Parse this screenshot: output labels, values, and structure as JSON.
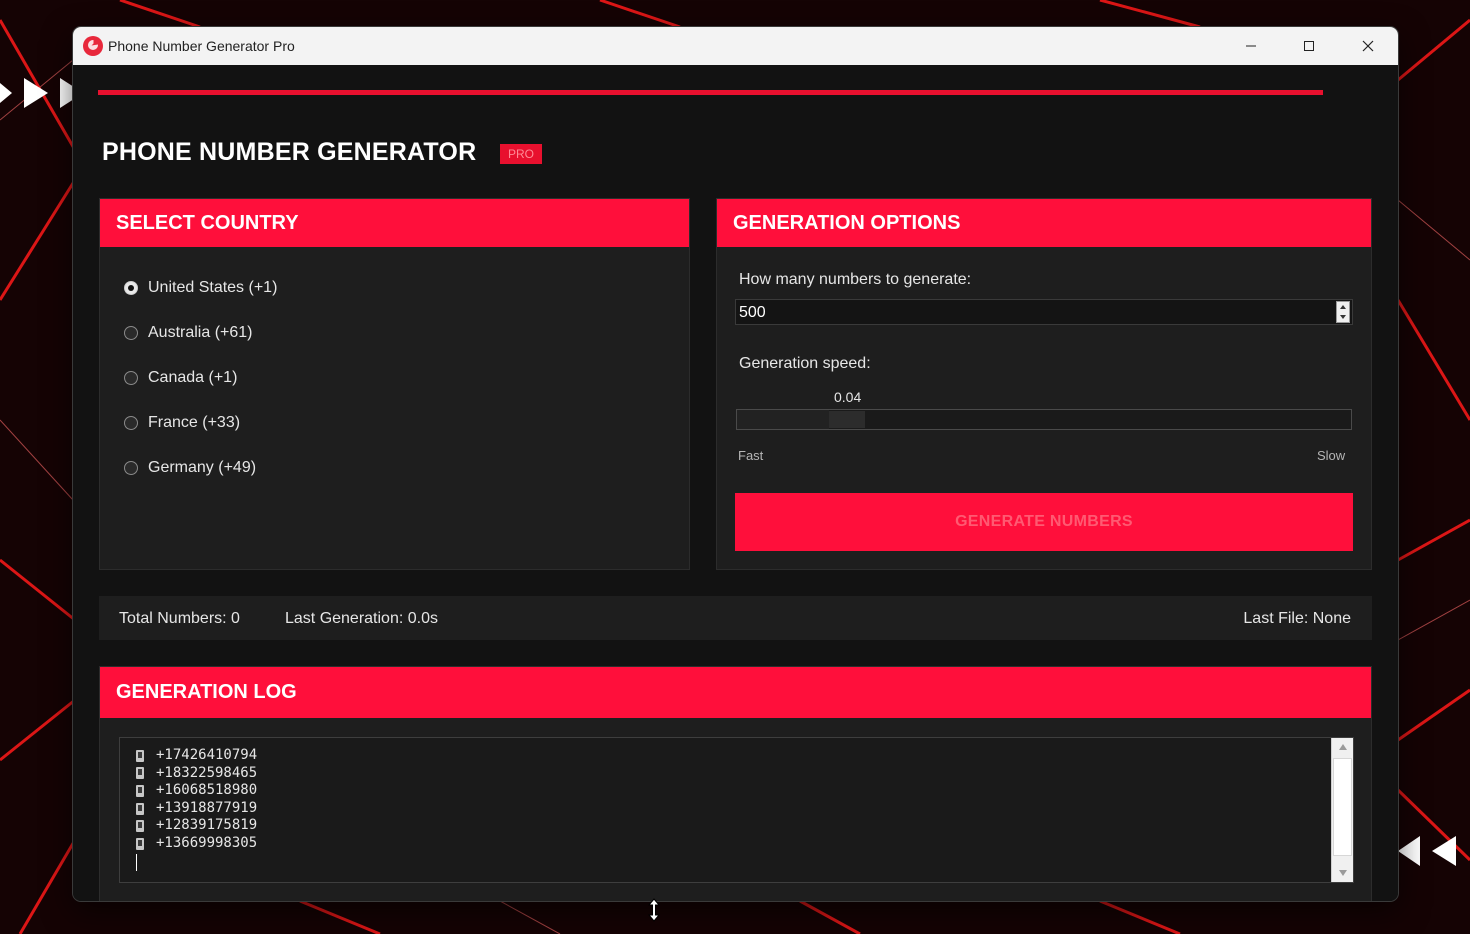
{
  "window": {
    "title": "Phone Number Generator Pro",
    "minimize_icon": "minimize-icon",
    "maximize_icon": "maximize-icon",
    "close_icon": "close-icon"
  },
  "header": {
    "title": "PHONE NUMBER GENERATOR",
    "badge": "PRO",
    "accent_color": "#ff0f3b"
  },
  "country_panel": {
    "title": "SELECT COUNTRY",
    "options": [
      {
        "label": "United States (+1)",
        "selected": true
      },
      {
        "label": "Australia (+61)",
        "selected": false
      },
      {
        "label": "Canada (+1)",
        "selected": false
      },
      {
        "label": "France (+33)",
        "selected": false
      },
      {
        "label": "Germany (+49)",
        "selected": false
      }
    ]
  },
  "options_panel": {
    "title": "GENERATION OPTIONS",
    "count_label": "How many numbers to generate:",
    "count_value": "500",
    "speed_label": "Generation speed:",
    "speed_value": "0.04",
    "speed_position": 0.15,
    "speed_min_label": "Fast",
    "speed_max_label": "Slow",
    "generate_button": "GENERATE NUMBERS"
  },
  "stats": {
    "total": "Total Numbers: 0",
    "last_generation": "Last Generation: 0.0s",
    "last_file": "Last File: None"
  },
  "log": {
    "title": "GENERATION LOG",
    "entries": [
      "+17426410794",
      "+18322598465",
      "+16068518980",
      "+13918877919",
      "+12839175819",
      "+13669998305"
    ]
  }
}
